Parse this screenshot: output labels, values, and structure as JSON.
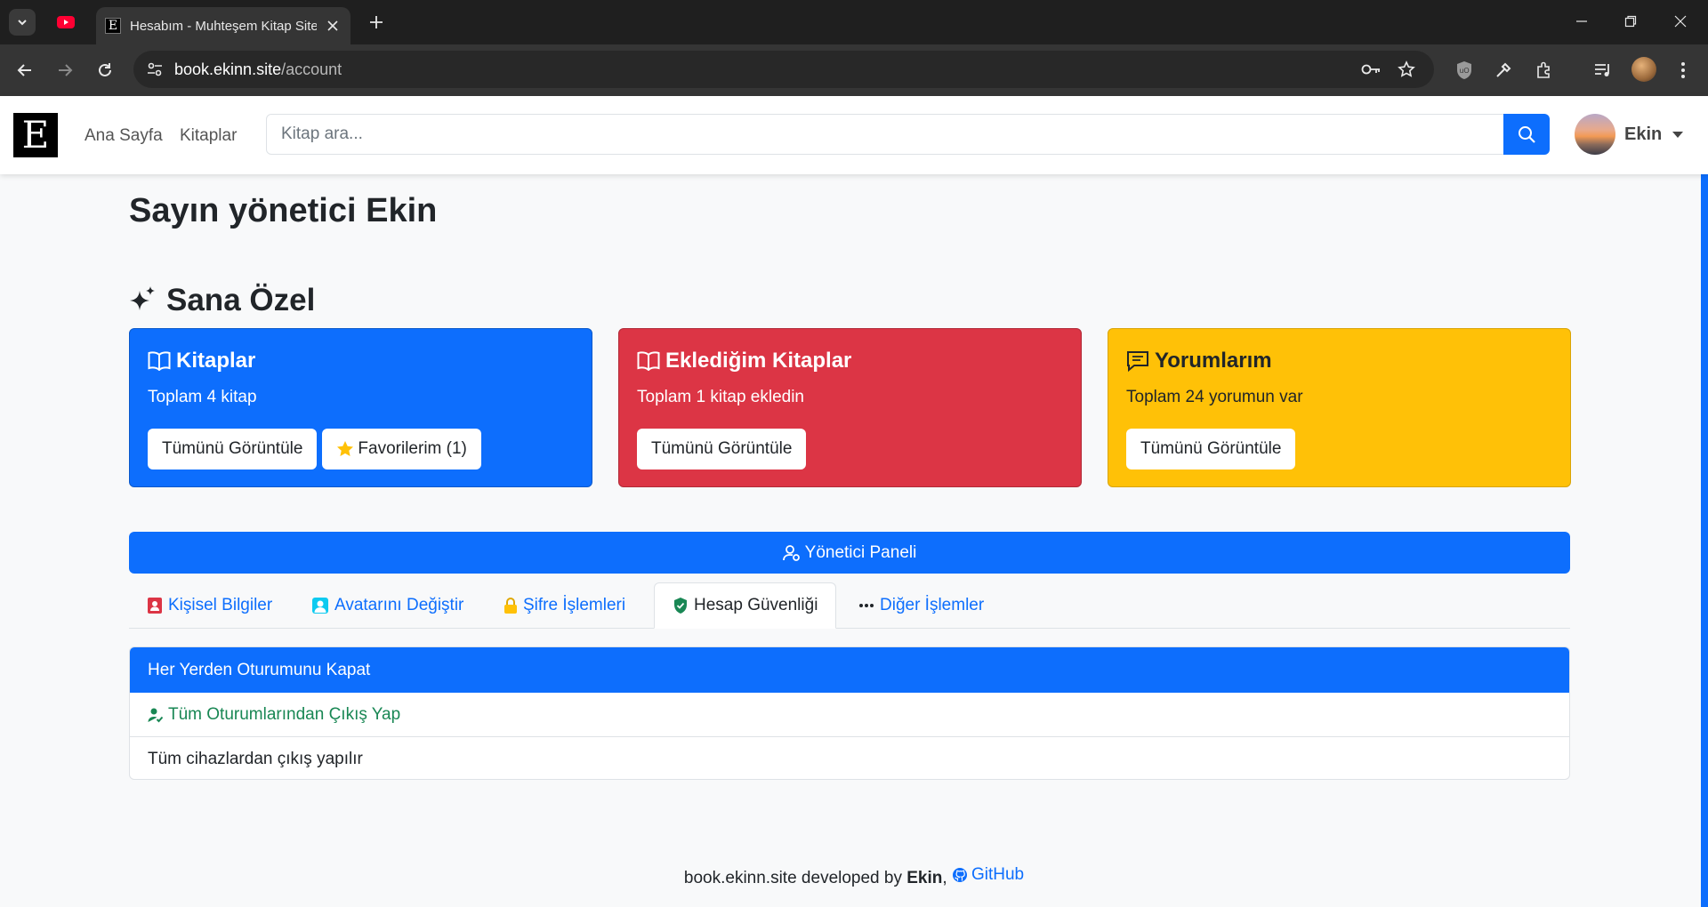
{
  "browser": {
    "tab_title": "Hesabım - Muhteşem Kitap Sitesi",
    "tab_favicon": "E",
    "url_host": "book.ekinn.site",
    "url_path": "/account"
  },
  "navbar": {
    "logo_letter": "E",
    "links": [
      "Ana Sayfa",
      "Kitaplar"
    ],
    "search_placeholder": "Kitap ara...",
    "user_name": "Ekin"
  },
  "greeting": "Sayın yönetici Ekin",
  "section_title": "Sana Özel",
  "cards": [
    {
      "title": "Kitaplar",
      "text": "Toplam 4 kitap",
      "buttons": [
        "Tümünü Görüntüle",
        "Favorilerim (1)"
      ],
      "color": "#0d6efd"
    },
    {
      "title": "Eklediğim Kitaplar",
      "text": "Toplam 1 kitap ekledin",
      "buttons": [
        "Tümünü Görüntüle"
      ],
      "color": "#dc3545"
    },
    {
      "title": "Yorumlarım",
      "text": "Toplam 24 yorumun var",
      "buttons": [
        "Tümünü Görüntüle"
      ],
      "color": "#ffc107"
    }
  ],
  "admin_button": "Yönetici Paneli",
  "tabs": [
    {
      "label": "Kişisel Bilgiler",
      "icon": "id-card-icon"
    },
    {
      "label": "Avatarını Değiştir",
      "icon": "avatar-icon"
    },
    {
      "label": "Şifre İşlemleri",
      "icon": "lock-icon"
    },
    {
      "label": "Hesap Güvenliği",
      "icon": "shield-icon",
      "active": true
    },
    {
      "label": "Diğer İşlemler",
      "icon": "more-icon"
    }
  ],
  "panel": {
    "header": "Her Yerden Oturumunu Kapat",
    "link": "Tüm Oturumlarından Çıkış Yap",
    "description": "Tüm cihazlardan çıkış yapılır"
  },
  "footer": {
    "text": "book.ekinn.site developed by",
    "author": "Ekin",
    "sep": ",",
    "github": "GitHub"
  },
  "colors": {
    "primary": "#0d6efd",
    "danger": "#dc3545",
    "warning": "#ffc107",
    "success": "#198754"
  }
}
